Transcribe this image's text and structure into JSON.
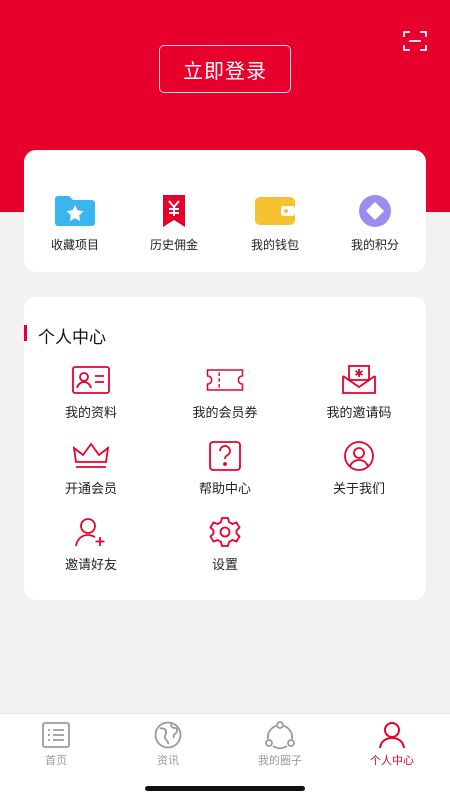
{
  "header": {
    "login_label": "立即登录",
    "scan_icon": "scan-icon"
  },
  "quick": {
    "items": [
      {
        "label": "收藏项目",
        "icon": "folder-star-icon",
        "color": "#3bb5f0"
      },
      {
        "label": "历史佣金",
        "icon": "yuan-bookmark-icon",
        "color": "#e8002d"
      },
      {
        "label": "我的钱包",
        "icon": "wallet-icon",
        "color": "#f7c232"
      },
      {
        "label": "我的积分",
        "icon": "points-diamond-icon",
        "color": "#9b8cf0"
      }
    ]
  },
  "center": {
    "title": "个人中心",
    "items": [
      {
        "label": "我的资料",
        "icon": "profile-card-icon"
      },
      {
        "label": "我的会员券",
        "icon": "coupon-icon"
      },
      {
        "label": "我的邀请码",
        "icon": "invite-code-icon"
      },
      {
        "label": "开通会员",
        "icon": "crown-icon"
      },
      {
        "label": "帮助中心",
        "icon": "help-icon"
      },
      {
        "label": "关于我们",
        "icon": "about-user-icon"
      },
      {
        "label": "邀请好友",
        "icon": "add-friend-icon"
      },
      {
        "label": "设置",
        "icon": "settings-gear-icon"
      }
    ]
  },
  "tabbar": {
    "tabs": [
      {
        "label": "首页",
        "icon": "home-list-icon",
        "active": false
      },
      {
        "label": "资讯",
        "icon": "globe-icon",
        "active": false
      },
      {
        "label": "我的圈子",
        "icon": "circle-share-icon",
        "active": false
      },
      {
        "label": "个人中心",
        "icon": "person-icon",
        "active": true
      }
    ]
  },
  "colors": {
    "brand_red": "#e8002d",
    "background": "#f2f2f2",
    "inactive_tab": "#9a9a9a"
  }
}
